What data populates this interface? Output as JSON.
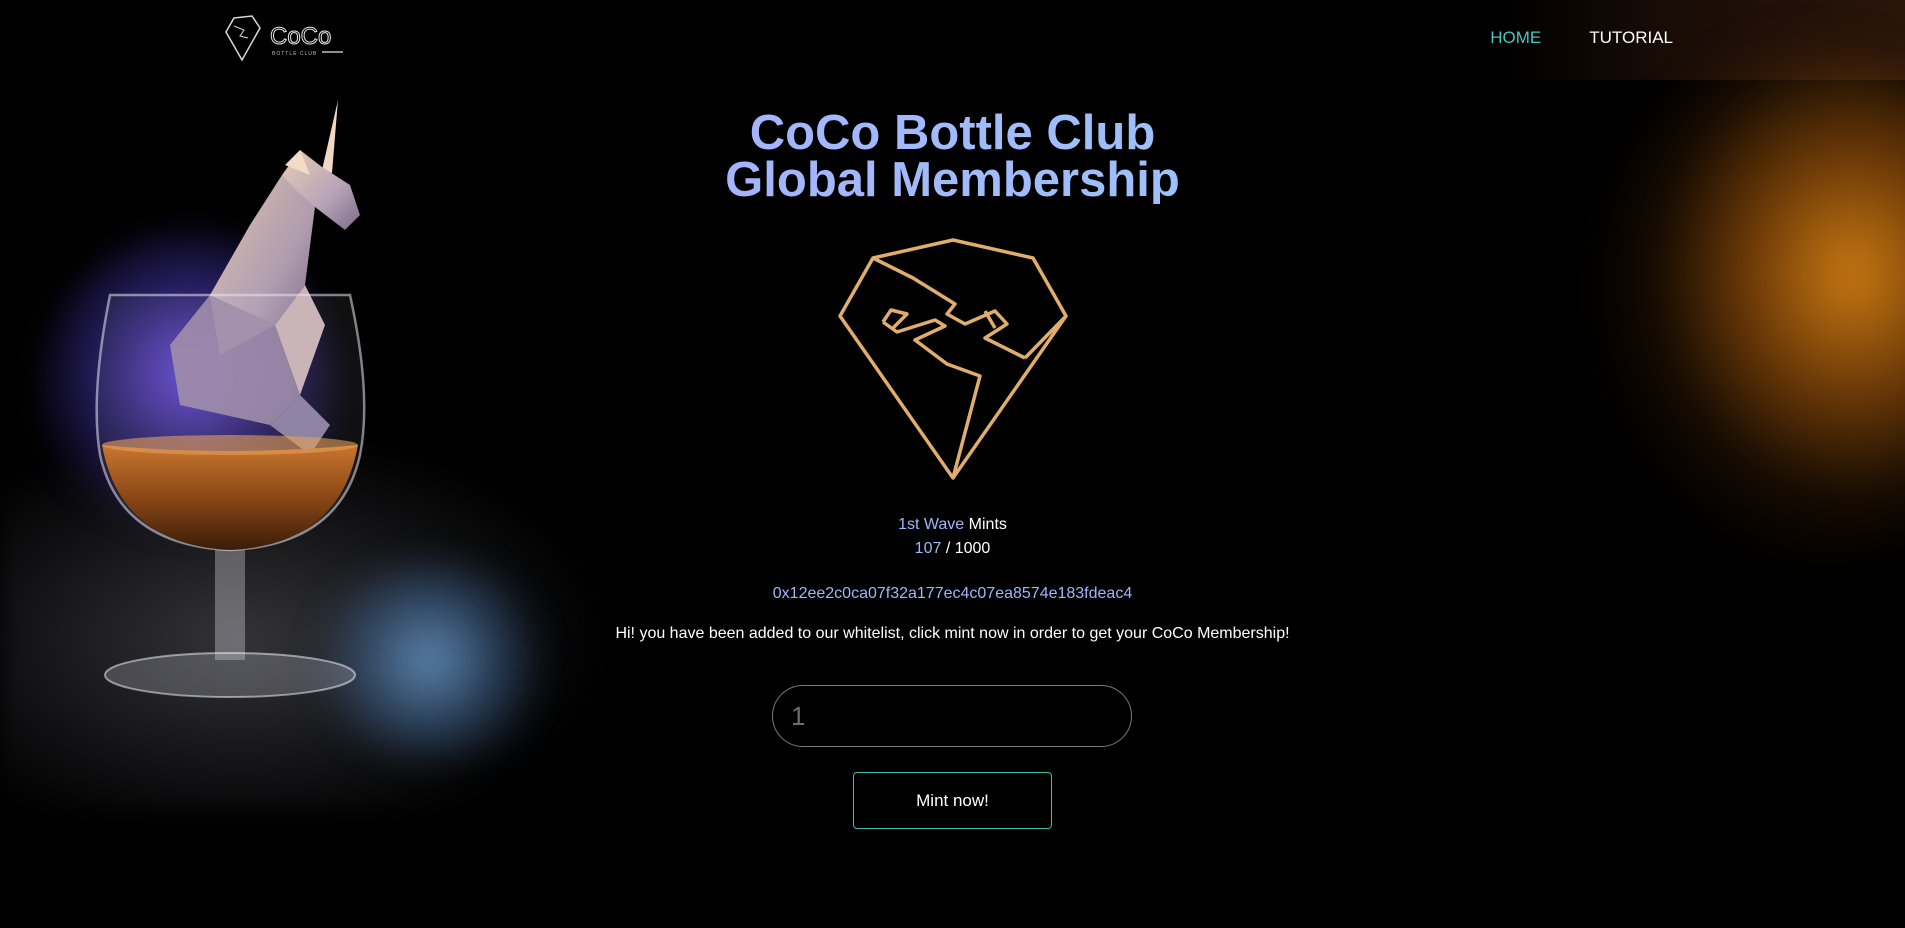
{
  "header": {
    "logo_text": "CoCo",
    "logo_subtext": "BOTTLE CLUB",
    "nav": [
      {
        "label": "HOME",
        "active": true
      },
      {
        "label": "TUTORIAL",
        "active": false
      }
    ]
  },
  "main": {
    "title_line1": "CoCo Bottle Club",
    "title_line2": "Global Membership",
    "wave_label": "1st Wave",
    "mints_label": "Mints",
    "minted": "107",
    "separator": "/",
    "total": "1000",
    "wallet_address": "0x12ee2c0ca07f32a177ec4c07ea8574e183fdeac4",
    "message": "Hi! you have been added to our whitelist, click mint now in order to get your CoCo Membership!",
    "quantity_placeholder": "1",
    "mint_button_label": "Mint now!"
  },
  "colors": {
    "accent_teal": "#49c6c0",
    "accent_blue": "#9fb7fb",
    "emblem_gold": "#e0ad6d",
    "background": "#000000"
  }
}
